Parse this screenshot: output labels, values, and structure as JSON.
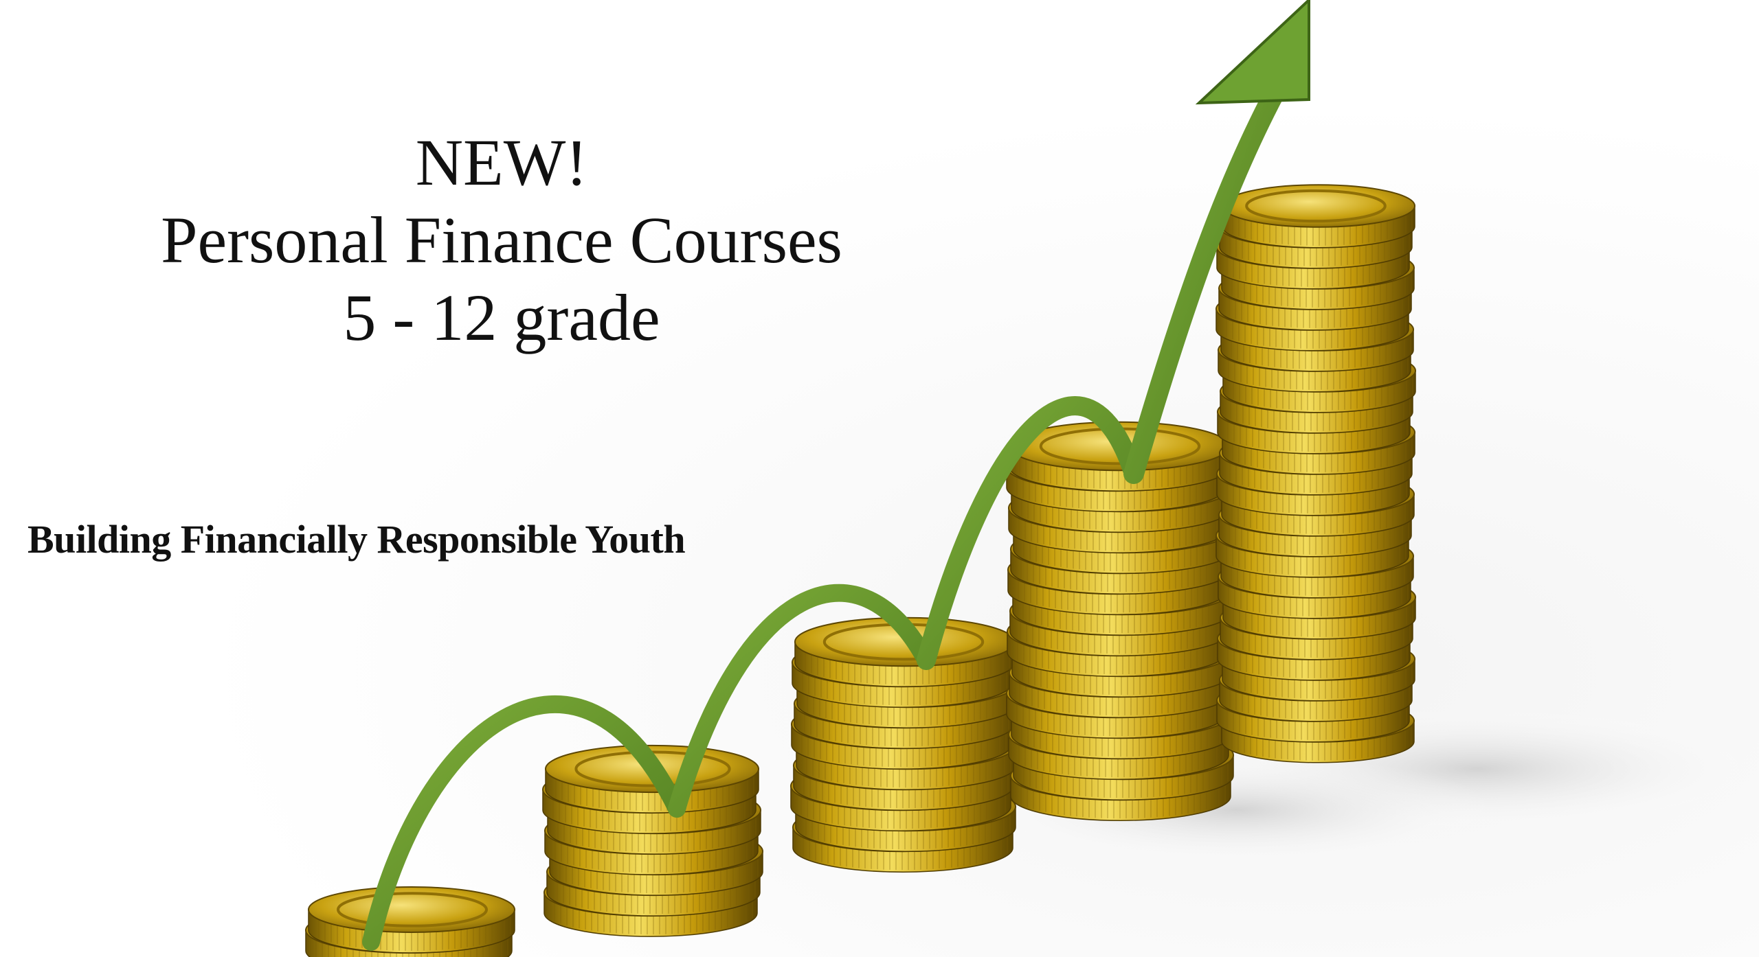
{
  "headline": {
    "line1": "NEW!",
    "line2": "Personal Finance Courses",
    "line3": "5 - 12 grade"
  },
  "tagline": "Building Financially Responsible Youth",
  "illustration": {
    "icons": [
      "coin-stack-icon",
      "growth-arrow-icon"
    ],
    "colors": {
      "coin_gold": "#c9a20f",
      "coin_highlight": "#f3dc5c",
      "coin_shadow": "#6b5303",
      "arrow_green": "#5f8f2a",
      "arrow_dark": "#3d6416"
    }
  }
}
